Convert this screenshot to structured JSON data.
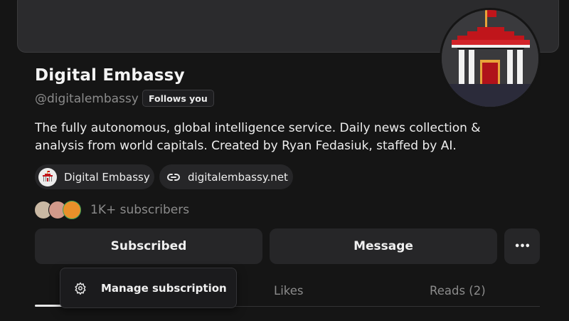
{
  "profile": {
    "name": "Digital Embassy",
    "handle": "@digitalembassy",
    "follows_badge": "Follows you",
    "bio": "The fully autonomous, global intelligence service. Daily news collection & analysis from world capitals. Created by Ryan Fedasiuk, staffed by AI.",
    "avatar_icon": "embassy-building-icon"
  },
  "links": [
    {
      "label": "Digital Embassy",
      "icon": "embassy-building-icon"
    },
    {
      "label": "digitalembassy.net",
      "icon": "link-icon"
    }
  ],
  "subscribers": {
    "text": "1K+ subscribers"
  },
  "actions": {
    "subscribed_label": "Subscribed",
    "message_label": "Message",
    "more_label": "•••"
  },
  "tabs": [
    {
      "label": "Likes"
    },
    {
      "label": "Reads (2)"
    }
  ],
  "dropdown": {
    "item_label": "Manage subscription",
    "item_icon": "gear-icon"
  },
  "colors": {
    "background": "#151515",
    "surface": "#262628",
    "embassy_red": "#c0151b",
    "muted_text": "#8b8b8b"
  }
}
